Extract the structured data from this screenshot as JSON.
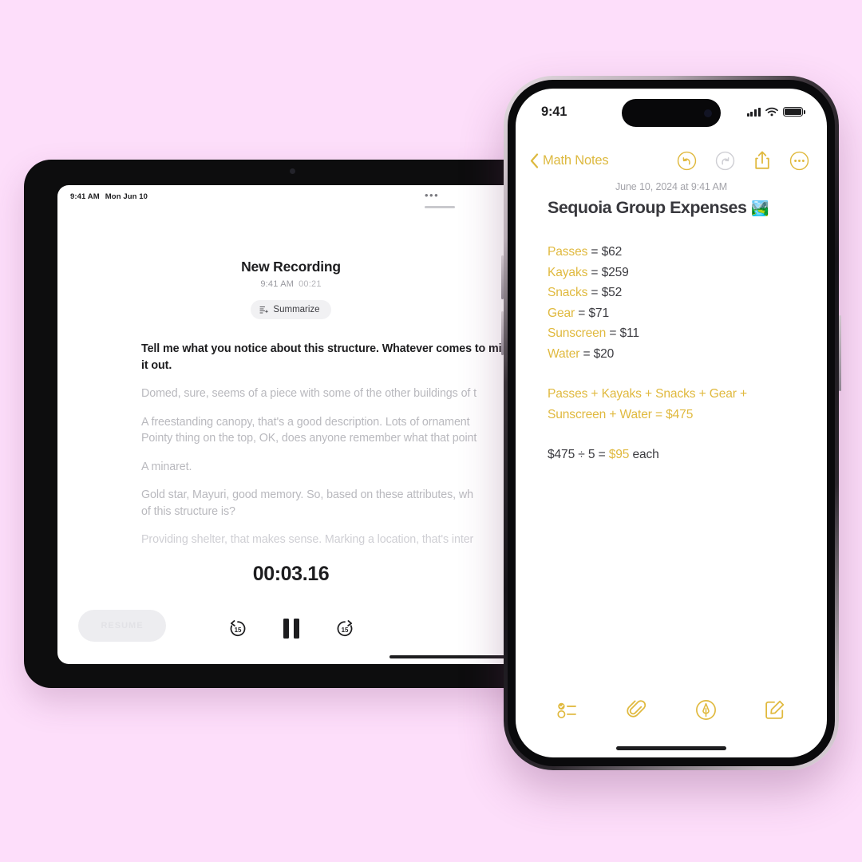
{
  "theme": {
    "background": "#FDDEFA",
    "accent_yellow": "#E0B93E",
    "text_dark": "#1D1D1F",
    "text_muted": "#A3A3A9"
  },
  "ipad": {
    "status_bar": {
      "time": "9:41 AM",
      "date": "Mon Jun 10"
    },
    "window_controls": {
      "more_dots": "•••"
    },
    "recording": {
      "title": "New Recording",
      "time": "9:41 AM",
      "duration": "00:21",
      "summarize_label": "Summarize",
      "summarize_icon": "sparkle-text-icon"
    },
    "transcript": [
      {
        "text": "Tell me what you notice about this structure. Whatever comes to mind, blurt it out.",
        "state": "active"
      },
      {
        "text": "Domed, sure, seems of a piece with some of the other buildings of t",
        "state": "normal"
      },
      {
        "text": "A freestanding canopy, that's a good description. Lots of ornament",
        "state": "normal"
      },
      {
        "text": "Pointy thing on the top, OK, does anyone remember what that point",
        "state": "normal"
      },
      {
        "text": "A minaret.",
        "state": "normal"
      },
      {
        "text": "Gold star, Mayuri, good memory. So, based on these attributes, wh",
        "state": "normal"
      },
      {
        "text": "of this structure is?",
        "state": "normal"
      },
      {
        "text": "Providing shelter, that makes sense. Marking a location, that's inter",
        "state": "faded"
      }
    ],
    "playback": {
      "timer": "00:03.16",
      "resume_label": "RESUME",
      "skip_back_label": "15",
      "skip_forward_label": "15",
      "skip_back_icon": "skip-back-15-icon",
      "pause_icon": "pause-icon",
      "skip_forward_icon": "skip-forward-15-icon"
    }
  },
  "phone": {
    "status_bar": {
      "time": "9:41",
      "signal_icon": "cellular-signal-icon",
      "wifi_icon": "wifi-icon",
      "battery_icon": "battery-icon"
    },
    "navbar": {
      "back_icon": "chevron-left-icon",
      "back_label": "Math Notes",
      "undo_icon": "undo-icon",
      "redo_icon": "redo-icon",
      "share_icon": "share-icon",
      "more_icon": "more-circle-icon"
    },
    "note": {
      "date": "June 10, 2024 at 9:41 AM",
      "title": "Sequoia Group Expenses",
      "title_emoji": "🏞️",
      "items": [
        {
          "label": "Passes",
          "eq": " = ",
          "value": "$62"
        },
        {
          "label": "Kayaks",
          "eq": " = ",
          "value": "$259"
        },
        {
          "label": "Snacks",
          "eq": " = ",
          "value": "$52"
        },
        {
          "label": "Gear",
          "eq": " = ",
          "value": "$71"
        },
        {
          "label": "Sunscreen",
          "eq": " = ",
          "value": "$11"
        },
        {
          "label": "Water",
          "eq": " = ",
          "value": "$20"
        }
      ],
      "sum_line_1_a": "Passes",
      "sum_line_1_p1": " + ",
      "sum_line_1_b": "Kayaks",
      "sum_line_1_p2": " + ",
      "sum_line_1_c": "Snacks",
      "sum_line_1_p3": " + ",
      "sum_line_1_d": "Gear",
      "sum_line_1_p4": " +",
      "sum_line_2_a": "Sunscreen",
      "sum_line_2_p1": " + ",
      "sum_line_2_b": "Water",
      "sum_line_2_eq": " = ",
      "sum_line_2_total": "$475",
      "divide_lhs": "$475 ÷ 5 = ",
      "divide_result": "$95",
      "divide_suffix": " each"
    },
    "toolbar": {
      "checklist_icon": "checklist-icon",
      "attachment_icon": "paperclip-icon",
      "markup_icon": "markup-pen-icon",
      "compose_icon": "compose-icon"
    }
  }
}
